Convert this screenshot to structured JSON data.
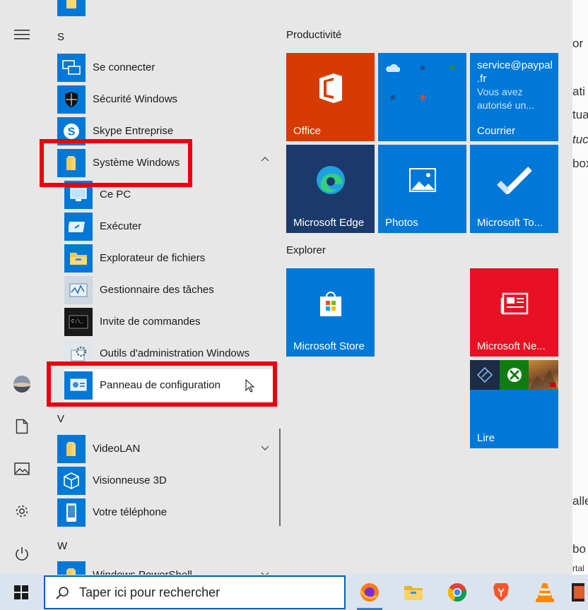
{
  "background": {
    "peek_lines": [
      "or",
      "ati",
      "tua",
      "tuc",
      "box",
      "alle",
      "bo",
      "rtal"
    ]
  },
  "start_menu": {
    "app_list": {
      "section_letters": [
        "S",
        "V",
        "W"
      ],
      "items": [
        {
          "label": "Se connecter",
          "icon": "remote-connect-icon"
        },
        {
          "label": "Sécurité Windows",
          "icon": "shield-icon"
        },
        {
          "label": "Skype Entreprise",
          "icon": "skype-icon"
        },
        {
          "label": "Système Windows",
          "icon": "folder-icon",
          "expanded": true
        },
        {
          "label": "Ce PC",
          "icon": "computer-icon"
        },
        {
          "label": "Exécuter",
          "icon": "run-icon"
        },
        {
          "label": "Explorateur de fichiers",
          "icon": "folder-icon"
        },
        {
          "label": "Gestionnaire des tâches",
          "icon": "task-manager-icon"
        },
        {
          "label": "Invite de commandes",
          "icon": "terminal-icon"
        },
        {
          "label": "Outils d'administration Windows",
          "icon": "admin-tools-icon"
        },
        {
          "label": "Panneau de configuration",
          "icon": "control-panel-icon"
        },
        {
          "label": "VideoLAN",
          "icon": "folder-icon",
          "expanded": false
        },
        {
          "label": "Visionneuse 3D",
          "icon": "cube-icon"
        },
        {
          "label": "Votre téléphone",
          "icon": "phone-icon"
        },
        {
          "label": "Windows PowerShell",
          "icon": "folder-icon"
        }
      ]
    },
    "tiles": {
      "groups": [
        {
          "title": "Productivité"
        },
        {
          "title": "Explorer"
        }
      ],
      "office": {
        "label": "Office",
        "color": "#d83b01"
      },
      "onedrive": {
        "color": "#0078d7"
      },
      "mail": {
        "sender": "service@paypal.fr",
        "sender_line1": "service@paypal",
        "sender_line2": ".fr",
        "preview1": "Vous avez",
        "preview2": "autorisé un...",
        "label": "Courrier",
        "color": "#0078d7"
      },
      "edge": {
        "label": "Microsoft Edge",
        "color": "#1b3a6b"
      },
      "photos": {
        "label": "Photos",
        "color": "#0078d7"
      },
      "todo": {
        "label": "Microsoft To...",
        "color": "#0078d7"
      },
      "store": {
        "label": "Microsoft Store",
        "color": "#0078d7"
      },
      "news": {
        "label": "Microsoft Ne...",
        "color": "#e81123"
      },
      "play": {
        "label": "Lire",
        "color": "#0078d7"
      }
    },
    "accent": "#0078d7",
    "highlight": "#e8000f"
  },
  "taskbar": {
    "search_placeholder": "Taper ici pour rechercher",
    "pinned_apps": [
      "firefox-icon",
      "file-explorer-icon",
      "chrome-icon",
      "brave-icon",
      "vlc-icon",
      "filmstrip-icon"
    ]
  }
}
